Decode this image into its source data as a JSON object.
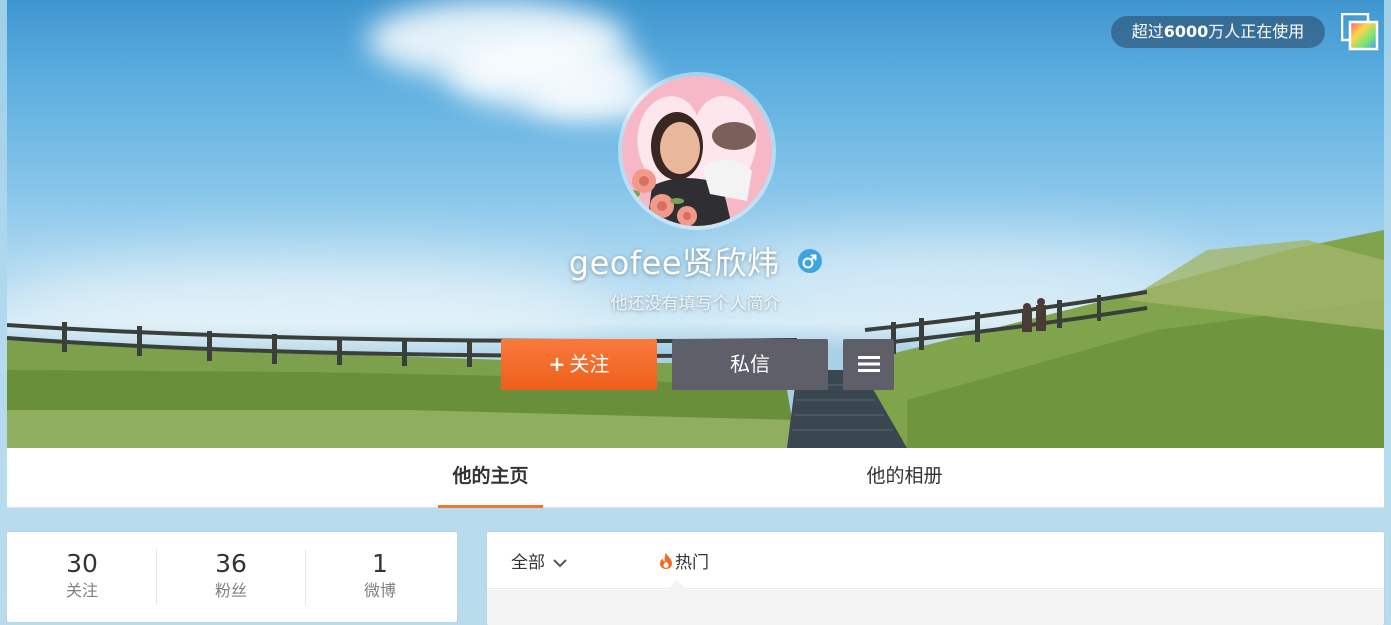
{
  "header": {
    "app_badge": {
      "prefix": "超过",
      "count": "6000",
      "suffix": "万人正在使用"
    }
  },
  "profile": {
    "nickname": "geofee贤欣炜",
    "gender_icon": "male-icon",
    "intro": "他还没有填写个人简介",
    "actions": {
      "follow_plus": "+",
      "follow_label": "关注",
      "message_label": "私信",
      "more_icon": "menu-icon"
    }
  },
  "tabs": [
    {
      "label": "他的主页",
      "active": true
    },
    {
      "label": "他的相册",
      "active": false
    }
  ],
  "stats": [
    {
      "value": "30",
      "label": "关注"
    },
    {
      "value": "36",
      "label": "粉丝"
    },
    {
      "value": "1",
      "label": "微博"
    }
  ],
  "feed": {
    "filter_label": "全部",
    "hot_label": "热门"
  },
  "colors": {
    "accent": "#f5742c",
    "follow_button": "#f26a25",
    "dark_button": "#5e5f69",
    "gender_blue": "#3da4e0"
  }
}
